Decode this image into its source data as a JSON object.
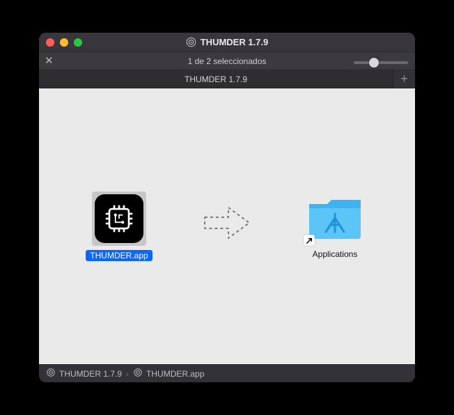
{
  "window": {
    "title": "THUMDER 1.7.9"
  },
  "toolbar": {
    "selection_text": "1 de 2 seleccionados",
    "slider_value": 35
  },
  "tabs": {
    "active": "THUMDER 1.7.9"
  },
  "items": {
    "app": {
      "label": "THUMDER.app"
    },
    "applications": {
      "label": "Applications"
    }
  },
  "breadcrumbs": {
    "root": "THUMDER 1.7.9",
    "leaf": "THUMDER.app"
  }
}
